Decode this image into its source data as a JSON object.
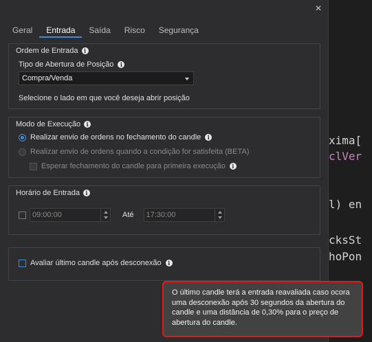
{
  "close_label": "×",
  "tabs": [
    "Geral",
    "Entrada",
    "Saída",
    "Risco",
    "Segurança"
  ],
  "active_tab": "Entrada",
  "ordem_entrada": {
    "title": "Ordem de Entrada",
    "tipo_label": "Tipo de Abertura de Posição",
    "tipo_value": "Compra/Venda",
    "helper": "Selecione o lado em que você deseja abrir posição"
  },
  "modo_execucao": {
    "title": "Modo de Execução",
    "opt1": "Realizar envio de ordens no fechamento do candle",
    "opt2": "Realizar envio de ordens quando a condição for satisfeita (BETA)",
    "opt3": "Esperar fechamento do candle para primeira execução"
  },
  "horario": {
    "title": "Horário de Entrada",
    "start": "09:00:00",
    "until_label": "Até",
    "end": "17:30:00"
  },
  "reconnect": {
    "label": "Avaliar último candle após desconexão"
  },
  "tooltip_text": "O último candle terá a entrada reavaliada caso ocora uma desconexão após 30 segundos da abertura do candle e uma distância de 0,30% para o preço de abertura do candle.",
  "background_code": {
    "line1": "xima[",
    "line2": "clVer",
    "line3": "l) en",
    "line4": "cksSt",
    "line5": "hoPon"
  },
  "colors": {
    "accent": "#3e8ede",
    "tooltip_border": "#e01b1b",
    "panel": "#2d2d30"
  }
}
